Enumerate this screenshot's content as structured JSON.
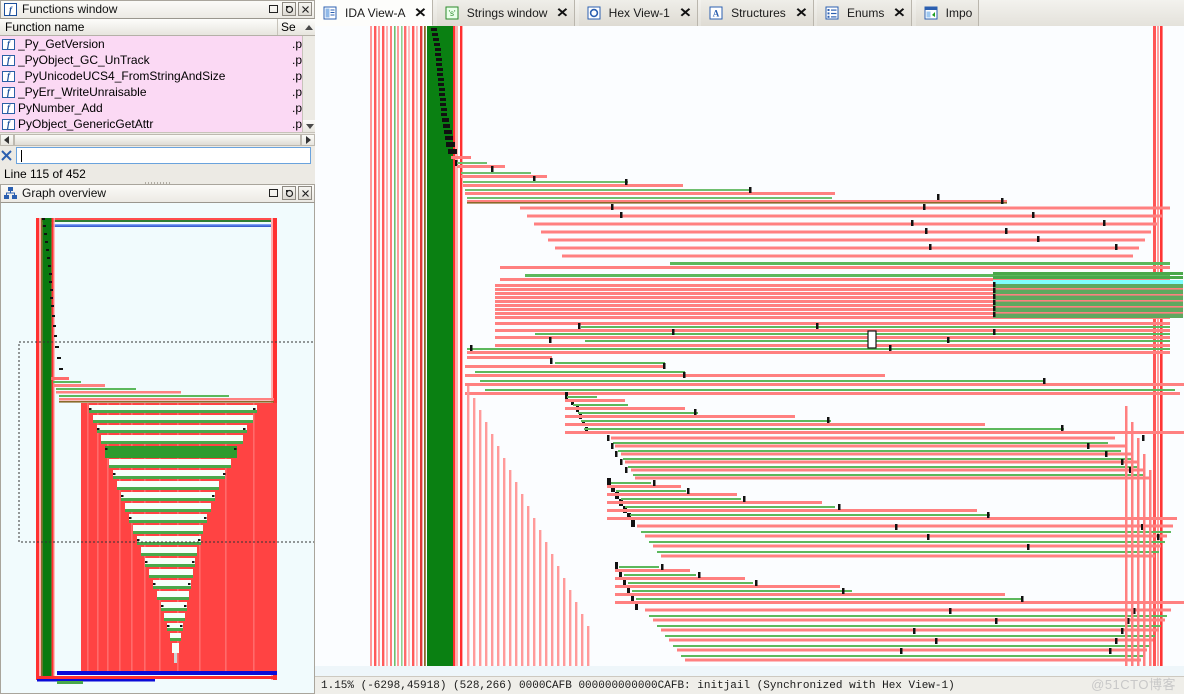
{
  "functions_window": {
    "title": "Functions window",
    "icon": "function-window-icon",
    "buttons": {
      "restore": "restore-window",
      "float": "float-window",
      "close": "close-window"
    },
    "columns": [
      "Function name",
      "Se"
    ],
    "rows": [
      {
        "icon": "function-icon",
        "name": "_Py_GetVersion",
        "segment": ".pl"
      },
      {
        "icon": "function-icon",
        "name": "_PyObject_GC_UnTrack",
        "segment": ".pl"
      },
      {
        "icon": "function-icon",
        "name": "_PyUnicodeUCS4_FromStringAndSize",
        "segment": ".pl"
      },
      {
        "icon": "function-icon",
        "name": "_PyErr_WriteUnraisable",
        "segment": ".pl"
      },
      {
        "icon": "function-icon",
        "name": "PyNumber_Add",
        "segment": ".pl"
      },
      {
        "icon": "function-icon",
        "name": "PyObject_GenericGetAttr",
        "segment": ".pl"
      }
    ],
    "filter": {
      "icon": "filter-icon",
      "value": "",
      "placeholder": ""
    },
    "status": "Line 115 of 452"
  },
  "graph_overview": {
    "title": "Graph overview",
    "icon": "graph-overview-icon",
    "buttons": {
      "restore": "restore-window",
      "float": "float-window",
      "close": "close-window"
    }
  },
  "tabs": [
    {
      "label": "IDA View-A",
      "icon": "ida-view-icon",
      "active": true,
      "close": "✕"
    },
    {
      "label": "Strings window",
      "icon": "strings-icon",
      "active": false,
      "close": "✕"
    },
    {
      "label": "Hex View-1",
      "icon": "hex-view-icon",
      "active": false,
      "close": "✕"
    },
    {
      "label": "Structures",
      "icon": "structures-icon",
      "active": false,
      "close": "✕"
    },
    {
      "label": "Enums",
      "icon": "enums-icon",
      "active": false,
      "close": "✕"
    },
    {
      "label": "Impo",
      "icon": "imports-icon",
      "active": false,
      "close": ""
    }
  ],
  "status_bar": {
    "text": "1.15% (-6298,45918) (528,266) 0000CAFB 000000000000CAFB: initjail (Synchronized with Hex View-1)",
    "zoom": "1.15%",
    "graph_coords": "(-6298,45918)",
    "screen_coords": "(528,266)",
    "address_short": "0000CAFB",
    "address_full": "000000000000CAFB",
    "symbol": "initjail",
    "sync_note": "(Synchronized with Hex View-1)"
  },
  "watermark": "@51CTO博客",
  "colors": {
    "edge_red": "#ff0000",
    "edge_red_light": "#ff8080",
    "edge_green": "#008000",
    "edge_green_light": "#5cb85c",
    "edge_cyan": "#7fffff",
    "edge_blue": "#0000ff",
    "graph_bg": "#fbfdff",
    "overview_bg": "#f1fbfd",
    "selection_pink": "#fbd9f4",
    "panel_bg": "#eceae4"
  }
}
